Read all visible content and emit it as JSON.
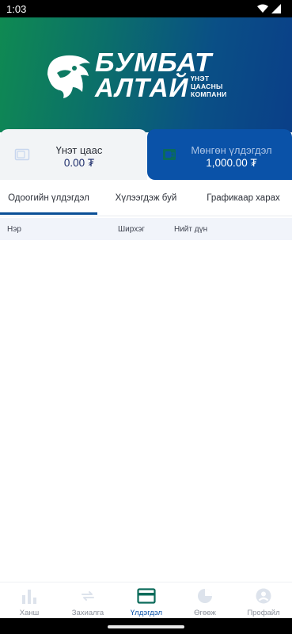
{
  "status": {
    "time": "1:03"
  },
  "banner": {
    "brand_line1": "БУМБАТ",
    "brand_line2": "АЛТАЙ",
    "tagline_line1": "ҮНЭТ",
    "tagline_line2": "ЦААСНЫ",
    "tagline_line3": "КОМПАНИ"
  },
  "balances": {
    "securities": {
      "title": "Үнэт цаас",
      "value": "0.00 ₮",
      "icon": "wallet-icon"
    },
    "cash": {
      "title": "Мөнгөн үлдэгдэл",
      "value": "1,000.00 ₮",
      "icon": "cash-icon"
    }
  },
  "tabs": [
    {
      "label": "Одоогийн үлдэгдэл",
      "active": true
    },
    {
      "label": "Хүлээгдэж буй",
      "active": false
    },
    {
      "label": "Графикаар харах",
      "active": false
    }
  ],
  "table": {
    "columns": [
      "Нэр",
      "Ширхэг",
      "Нийт дүн"
    ],
    "rows": []
  },
  "bottom_nav": [
    {
      "label": "Ханш",
      "icon": "bar-chart-icon",
      "active": false
    },
    {
      "label": "Захиалга",
      "icon": "swap-icon",
      "active": false
    },
    {
      "label": "Үлдэгдэл",
      "icon": "card-icon",
      "active": true
    },
    {
      "label": "Өгөөж",
      "icon": "pie-chart-icon",
      "active": false
    },
    {
      "label": "Профайл",
      "icon": "user-icon",
      "active": false
    }
  ],
  "colors": {
    "primary": "#0a52a8",
    "accent_green": "#0f8a52",
    "inactive": "#8a8f99"
  }
}
